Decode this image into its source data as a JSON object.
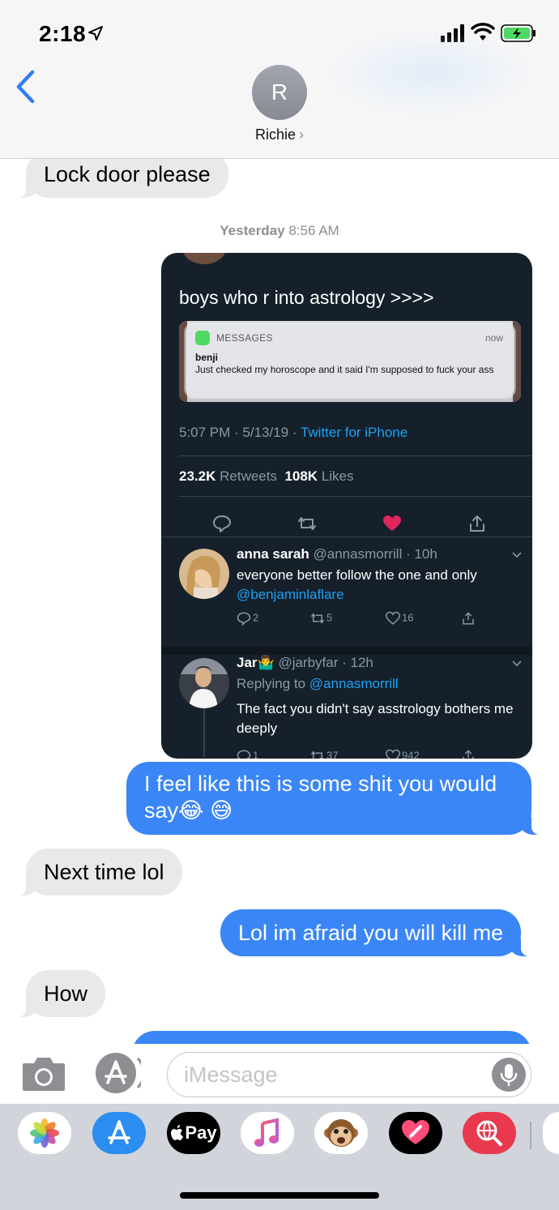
{
  "status_bar": {
    "time": "2:18"
  },
  "header": {
    "avatar_initial": "R",
    "contact_name": "Richie",
    "contact_chevron": "›"
  },
  "messages": {
    "m1": "Lock door please",
    "timestamp_day": "Yesterday",
    "timestamp_time": "8:56 AM",
    "m2": "I feel like this is some shit you would say😂 😅",
    "m3": "Next time lol",
    "m4": "Lol im afraid you will kill me",
    "m5": "How"
  },
  "tweet": {
    "text": "boys who r into astrology >>>>",
    "notification": {
      "app": "MESSAGES",
      "time": "now",
      "from": "benji",
      "body": "Just checked my horoscope and it said I'm supposed to fuck your ass"
    },
    "meta_time": "5:07 PM · 5/13/19 · ",
    "meta_source": "Twitter for iPhone",
    "retweets_count": "23.2K",
    "retweets_label": "Retweets",
    "likes_count": "108K",
    "likes_label": "Likes",
    "replies": [
      {
        "name": "anna sarah",
        "handle": "@annasmorrill · 10h",
        "text": "everyone better follow the one and only ",
        "mention": "@benjaminlaflare",
        "reply_count": "2",
        "retweet_count": "5",
        "like_count": "16"
      },
      {
        "name": "Jar🤷‍♂️",
        "handle": "@jarbyfar · 12h",
        "replying_label": "Replying to ",
        "replying_to": "@annasmorrill",
        "text": "The fact you didn't say asstrology bothers me deeply",
        "reply_count": "1",
        "retweet_count": "37",
        "like_count": "942"
      }
    ]
  },
  "input": {
    "placeholder": "iMessage"
  },
  "colors": {
    "imessage_blue": "#3b86f7",
    "received_gray": "#e9e9eb",
    "twitter_bg": "#15202b",
    "twitter_blue": "#1da1f2",
    "like_red": "#e0245e"
  },
  "app_drawer": [
    "photos-app",
    "app-store",
    "apple-pay",
    "music",
    "animoji",
    "digital-touch",
    "web-search"
  ],
  "app_drawer_labels": {
    "pay": "Pay"
  }
}
